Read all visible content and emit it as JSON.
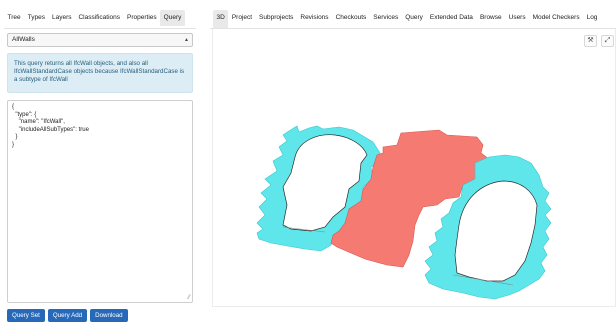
{
  "left_tabs": [
    "Tree",
    "Types",
    "Layers",
    "Classifications",
    "Properties",
    "Query"
  ],
  "active_left_tab": "Query",
  "query_select": {
    "value": "AllWalls"
  },
  "info_text": "This query returns all IfcWall objects, and also all IfcWallStandardCase objects because IfcWallStandardCase is a subtype of IfcWall",
  "query_json": "{\n  \"type\": {\n    \"name\": \"IfcWall\",\n    \"includeAllSubTypes\": true\n  }\n}",
  "buttons": {
    "query_set": "Query Set",
    "query_add": "Query Add",
    "download": "Download"
  },
  "right_tabs": [
    "3D",
    "Project",
    "Subprojects",
    "Revisions",
    "Checkouts",
    "Services",
    "Query",
    "Extended Data",
    "Browse",
    "Users",
    "Model Checkers",
    "Log"
  ],
  "active_right_tab": "3D",
  "icons": {
    "settings": "wrench-icon",
    "fullscreen": "expand-icon"
  },
  "colors": {
    "wall_cyan": "#5fe6ea",
    "wall_red": "#f47a72",
    "button_blue": "#2769b8",
    "info_bg": "#dcedf6"
  }
}
